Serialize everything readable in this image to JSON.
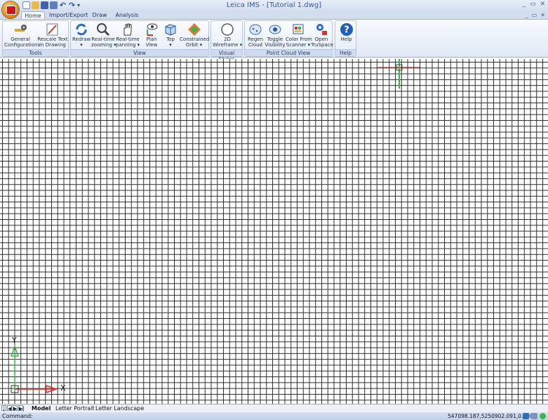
{
  "window": {
    "title": "Leica IMS  - [Tutorial 1.dwg]",
    "controls": [
      "_",
      "▭",
      "✕"
    ],
    "doc_controls": [
      "_",
      "▭",
      "✕"
    ]
  },
  "quick_access": {
    "more": "▾",
    "undo": "↶",
    "redo": "↷"
  },
  "tabs": [
    "Home",
    "Import/Export",
    "Draw",
    "Analysis"
  ],
  "ribbon": {
    "tools": {
      "title": "Tools",
      "general": [
        "General",
        "Configurations"
      ],
      "rescale": [
        "Rescale Text",
        "in Drawing"
      ]
    },
    "view": {
      "title": "View",
      "redraw": [
        "Redraw",
        "▾"
      ],
      "zoom": [
        "Real-time",
        "zooming ▾"
      ],
      "pan": [
        "Real-time",
        "panning ▾"
      ],
      "plan": [
        "Plan",
        "View"
      ],
      "top": [
        "Top",
        "▾"
      ],
      "orbit": [
        "Constrained",
        "Orbit ▾"
      ]
    },
    "visual_styles": {
      "title": "Visual Styles",
      "wireframe": [
        "2D",
        "Wireframe ▾"
      ]
    },
    "point_cloud": {
      "title": "Point Cloud View",
      "regen": [
        "Regen",
        "Cloud"
      ],
      "toggle": [
        "Toggle",
        "Visibility"
      ],
      "color": [
        "Color From",
        "Scanner ▾"
      ],
      "truspace": [
        "Open",
        "TruSpace"
      ]
    },
    "help": {
      "title": "Help",
      "help": [
        "Help"
      ]
    }
  },
  "canvas": {
    "ucs_x": "X",
    "ucs_y": "Y",
    "accent_x": "#e0302a",
    "accent_y": "#3bb54a"
  },
  "layout_tabs": {
    "nav": [
      "|◀",
      "◀",
      "▶",
      "▶|"
    ],
    "items": [
      "Model",
      "Letter Portrait",
      "Letter Landscape"
    ],
    "active": "Model"
  },
  "status": {
    "command_label": "Command:",
    "coordinates": "547098.187,5250902.091,0.000"
  }
}
